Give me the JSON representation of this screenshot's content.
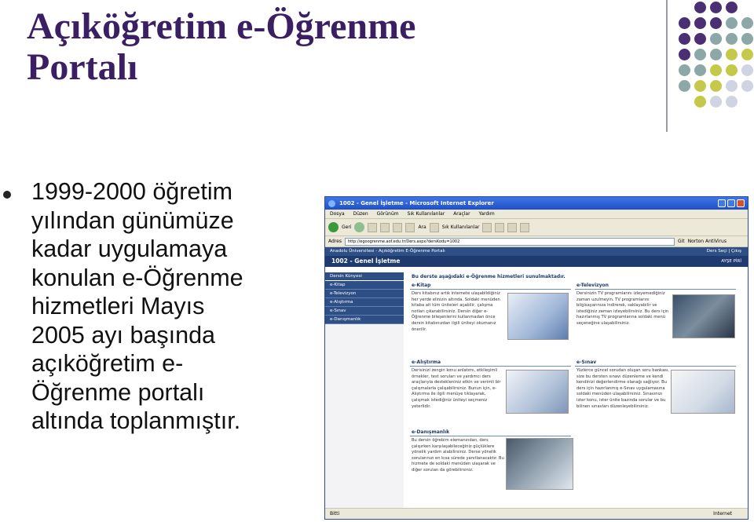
{
  "slide": {
    "title_line1": "Açıköğretim e-Öğrenme",
    "title_line2": "Portalı",
    "bullet_lines": [
      "1999-2000 öğretim",
      "yılından günümüze",
      "kadar uygulamaya",
      "konulan e-Öğrenme",
      "hizmetleri Mayıs",
      "2005 ayı başında",
      "açıköğretim e-",
      "Öğrenme portalı",
      "altında toplanmıştır."
    ],
    "dot_colors": [
      "#4a2f73",
      "#8ba7a6",
      "#c4c94a",
      "#cfd3e2"
    ]
  },
  "browser": {
    "window_title": "1002 - Genel İşletme - Microsoft Internet Explorer",
    "menu": [
      "Dosya",
      "Düzen",
      "Görünüm",
      "Sık Kullanılanlar",
      "Araçlar",
      "Yardım"
    ],
    "toolbar": {
      "back": "Geri",
      "search": "Ara",
      "favorites": "Sık Kullanılanlar"
    },
    "address_label": "Adres",
    "address_value": "http://egoogrenme.aof.edu.tr/Ders.aspx?dersKodu=1002",
    "go_label": "Git",
    "norton": "Norton AntiVirus",
    "page_header_left": "Anadolu Üniversitesi - Açıköğretim E-Öğrenme Portalı",
    "page_header_right": "Ders Seçi | Çıkış",
    "course_title": "1002 - Genel İşletme",
    "user": "AYŞE PİRİ",
    "sidebar": {
      "heading": "Dersin Künyesi",
      "items": [
        "e-Kitap",
        "e-Televizyon",
        "e-Alıştırma",
        "e-Sınav",
        "e-Danışmanlık"
      ]
    },
    "intro": "Bu derste aşağıdaki e-Öğrenme hizmetleri sunulmaktadır.",
    "panels": {
      "kitap": {
        "title": "e-Kitap",
        "text": "Ders kitabınız artık internete ulaşabildiğiniz her yerde elinizin altında. Soldaki menüden kitaba ait tüm üniteleri açabilir, çalışma notları çıkarabilirsiniz. Dersin diğer e-Öğrenme bileşenlerini kullanmadan önce dersin kitabınızdan ilgili üniteyi okumanız önerilir."
      },
      "televizyon": {
        "title": "e-Televizyon",
        "text": "Dersinizin TV programlarını izleyemediğiniz zaman uzulmeyin. TV programlarını bilgisayarınıza indirerek, saklayabilir ve istediğiniz zaman izleyebilirsiniz. Bu ders için hazırlanmış TV programlarına soldaki menü seçeneğine ulaşabilirsiniz."
      },
      "alistirma": {
        "title": "e-Alıştırma",
        "text": "Derisinizi zengin konu anlatımı, etkileşimli örnekler, test soruları ve yardımcı ders araçlarıyla destekleniniz etkin ve verimli bir çalışmalarla çalışabilirsiniz. Bunun için, e-Alıştırma ile ilgili menüye tıklayarak, çalışmak istediğiniz üniteyi seçmeniz yeterlidir."
      },
      "sinav": {
        "title": "e-Sınav",
        "text": "Yüzlerce güncel sorudan oluşan soru bankası, size bu dersten sınavı düzenleme ve kendi kendinizi değerlendirme olanağı sağlıyor. Bu ders için hazırlanmış e-Sınav uygulamasına soldaki menüden ulaşabilirsiniz. Sınavınızı ister konu, ister ünite bazında sorular ve bu bilinen sınavları düzenleyebilirsiniz."
      },
      "danismanlik": {
        "title": "e-Danışmanlık",
        "text": "Bu dersin öğrebim elemanından, ders çalışırken karşılaşabileceğiniz güçlüklere yönelik yardım alabilirsiniz. Derse yönelik sorularınızı en kısa sürede yanıtlanacaktır. Bu hizmete de soldaki menüden ulaşarak ve diğer sorulan da görebilirsiniz."
      }
    },
    "status_left": "Bitti",
    "status_right": "Internet"
  }
}
